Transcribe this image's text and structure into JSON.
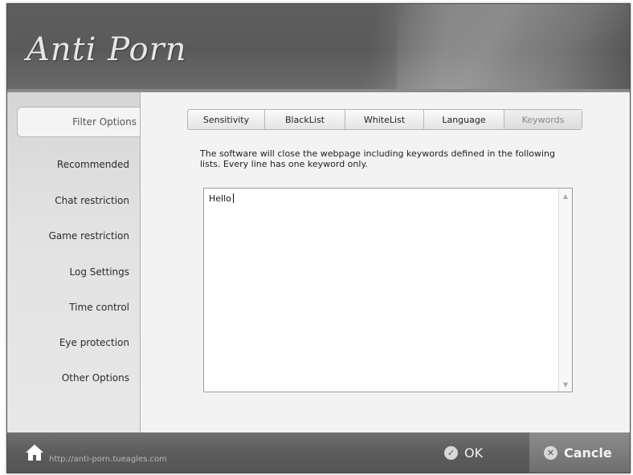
{
  "app": {
    "title": "Anti Porn"
  },
  "sidebar": {
    "items": [
      {
        "label": "Filter Options",
        "active": true
      },
      {
        "label": "Recommended"
      },
      {
        "label": "Chat restriction"
      },
      {
        "label": "Game restriction"
      },
      {
        "label": "Log Settings"
      },
      {
        "label": "Time control"
      },
      {
        "label": "Eye protection"
      },
      {
        "label": "Other Options"
      }
    ]
  },
  "tabs": [
    {
      "label": "Sensitivity"
    },
    {
      "label": "BlackList"
    },
    {
      "label": "WhiteList"
    },
    {
      "label": "Language"
    },
    {
      "label": "Keywords",
      "selected": true
    }
  ],
  "main": {
    "description": "The software will close the webpage including keywords defined in the following lists. Every line has one keyword only.",
    "keywords_value": "Hello"
  },
  "footer": {
    "url": "http://anti-porn.tueagles.com",
    "ok_label": "OK",
    "cancel_label": "Cancle"
  },
  "icons": {
    "home": "home-icon",
    "ok": "check-circle-icon",
    "cancel": "close-circle-icon",
    "scroll_up": "chevron-up-icon",
    "scroll_down": "chevron-down-icon"
  }
}
